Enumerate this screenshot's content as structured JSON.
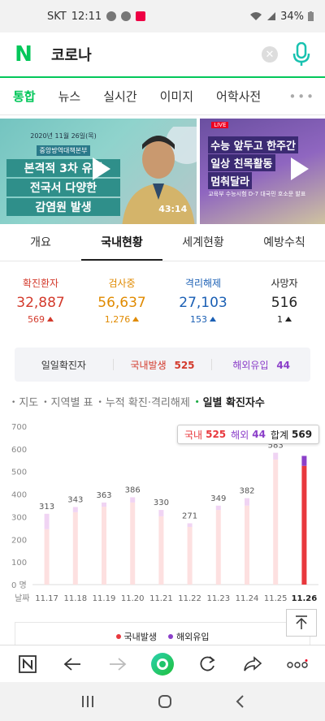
{
  "status": {
    "carrier": "SKT",
    "time": "12:11",
    "battery": "34%"
  },
  "search": {
    "query": "코로나"
  },
  "tabs": [
    "통합",
    "뉴스",
    "실시간",
    "이미지",
    "어학사전"
  ],
  "tabs_more": "•••",
  "videos": [
    {
      "date": "2020년 11월 26일(목)",
      "org": "중앙방역대책본부",
      "line1": "본격적 3차 유행",
      "line2": "전국서 다양한",
      "line3": "감염원 발생",
      "duration": "43:14"
    },
    {
      "live": "LIVE",
      "line1": "수능 앞두고 한주간",
      "line2": "일상 친목활동",
      "line3": "멈춰달라",
      "sub": "교육부 수능시험 D-7 대국민 호소문 발표"
    }
  ],
  "subtabs": [
    "개요",
    "국내현황",
    "세계현황",
    "예방수칙"
  ],
  "stats": [
    {
      "label": "확진환자",
      "value": "32,887",
      "change": "569",
      "color": "#d33a2c"
    },
    {
      "label": "검사중",
      "value": "56,637",
      "change": "1,276",
      "color": "#e08a00"
    },
    {
      "label": "격리해제",
      "value": "27,103",
      "change": "153",
      "color": "#1a5fb4"
    },
    {
      "label": "사망자",
      "value": "516",
      "change": "1",
      "color": "#222222"
    }
  ],
  "daily": {
    "label": "일일확진자",
    "domestic_label": "국내발생",
    "domestic_value": "525",
    "overseas_label": "해외유입",
    "overseas_value": "44"
  },
  "chart_nav": [
    "지도",
    "지역별 표",
    "누적 확진·격리해제",
    "일별 확진자수"
  ],
  "tooltip": {
    "domestic_label": "국내",
    "domestic": "525",
    "overseas_label": "해외",
    "overseas": "44",
    "total_label": "합계",
    "total": "569"
  },
  "chart_data": {
    "type": "bar",
    "categories": [
      "11.17",
      "11.18",
      "11.19",
      "11.20",
      "11.21",
      "11.22",
      "11.23",
      "11.24",
      "11.25",
      "11.26"
    ],
    "series": [
      {
        "name": "국내발생",
        "values": [
          245,
          320,
          344,
          363,
          302,
          255,
          330,
          349,
          553,
          525
        ]
      },
      {
        "name": "해외유입",
        "values": [
          68,
          23,
          19,
          23,
          28,
          16,
          19,
          33,
          30,
          44
        ]
      }
    ],
    "totals": [
      313,
      343,
      363,
      386,
      330,
      271,
      349,
      382,
      583,
      569
    ],
    "ylim": [
      0,
      700
    ],
    "yticks": [
      0,
      100,
      200,
      300,
      400,
      500,
      600,
      700
    ],
    "ytick_labels": [
      "0 명",
      "100",
      "200",
      "300",
      "400",
      "500",
      "600",
      "700"
    ],
    "xlabel": "날짜",
    "legend": [
      "국내발생",
      "해외유입"
    ],
    "colors": {
      "domestic": "#e8383d",
      "overseas": "#8b3fc9",
      "domestic_faded": "#fde0e0",
      "overseas_faded": "#f0d4f3"
    }
  }
}
